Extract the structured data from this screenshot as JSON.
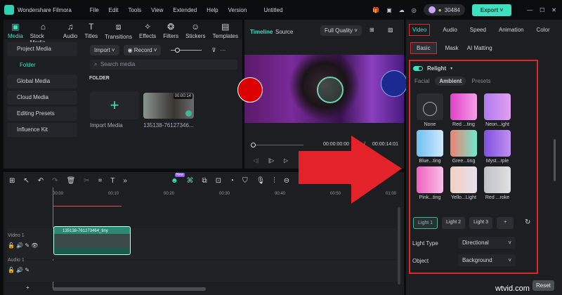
{
  "app": {
    "title": "Wondershare Filmora",
    "menu": [
      "File",
      "Edit",
      "Tools",
      "View",
      "Extended",
      "Help",
      "Version"
    ],
    "project": "Untitled",
    "credits": "30484",
    "export": "Export"
  },
  "toolbar": [
    {
      "label": "Media",
      "icon": "media-icon"
    },
    {
      "label": "Stock Media",
      "icon": "store-icon"
    },
    {
      "label": "Audio",
      "icon": "music-icon"
    },
    {
      "label": "Titles",
      "icon": "text-icon"
    },
    {
      "label": "Transitions",
      "icon": "transition-icon"
    },
    {
      "label": "Effects",
      "icon": "sparkle-icon"
    },
    {
      "label": "Filters",
      "icon": "filter-icon"
    },
    {
      "label": "Stickers",
      "icon": "sticker-icon"
    },
    {
      "label": "Templates",
      "icon": "template-icon"
    }
  ],
  "sidebar": [
    "Project Media",
    "Folder",
    "Global Media",
    "Cloud Media",
    "Editing Presets",
    "Influence Kit"
  ],
  "media": {
    "import": "Import",
    "record": "Record",
    "search_placeholder": "Search media",
    "folder_heading": "FOLDER",
    "import_media": "Import Media",
    "clip_name": "135138-76127346...",
    "clip_duration": "00:00:14"
  },
  "preview": {
    "tab_timeline": "Timeline",
    "tab_source": "Source",
    "quality": "Full Quality",
    "current_time": "00:00:00:00",
    "separator": "/",
    "total_time": "00:00:14:01"
  },
  "right": {
    "tabs": [
      "Video",
      "Audio",
      "Speed",
      "Animation",
      "Color"
    ],
    "subtabs": [
      "Basic",
      "Mask",
      "AI Matting"
    ],
    "relight": "Relight",
    "modes": [
      "Facial",
      "Ambient",
      "Presets"
    ],
    "presets": [
      {
        "name": "None",
        "bg": "#2a2c31"
      },
      {
        "name": "Red ...ting",
        "bg": "linear-gradient(90deg,#e040c8,#f7a0e8)"
      },
      {
        "name": "Neon...ight",
        "bg": "linear-gradient(90deg,#b07af0,#e0a0f0)"
      },
      {
        "name": "Blue...ting",
        "bg": "linear-gradient(90deg,#70c0f0,#d0e8ff)"
      },
      {
        "name": "Gree...ting",
        "bg": "linear-gradient(90deg,#f08070,#70e8d0)"
      },
      {
        "name": "Myst...rple",
        "bg": "linear-gradient(90deg,#8050e0,#c090f0)"
      },
      {
        "name": "Pink...ting",
        "bg": "linear-gradient(90deg,#f060c0,#f8c0e8)"
      },
      {
        "name": "Yello...Light",
        "bg": "linear-gradient(90deg,#f0d0c0,#e8e0f0)"
      },
      {
        "name": "Red ...roke",
        "bg": "linear-gradient(90deg,#c0c0c8,#e0e0e0)"
      }
    ],
    "lights": [
      "Light 1",
      "Light 2",
      "Light 3",
      "+"
    ],
    "light_type_label": "Light Type",
    "light_type": "Directional",
    "object_label": "Object",
    "object": "Background",
    "reset": "Reset"
  },
  "timeline": {
    "ticks": [
      "00:00",
      "00:10",
      "00:20",
      "00:30",
      "00:40",
      "00:50",
      "01:00"
    ],
    "video_track": "Video 1",
    "audio_track": "Audio 1",
    "clip": "135138-761273464_tiny",
    "new_badge": "New"
  },
  "watermark": "wtvid.com",
  "colors": {
    "accent": "#3fe0c0",
    "highlight": "#e0262b"
  }
}
